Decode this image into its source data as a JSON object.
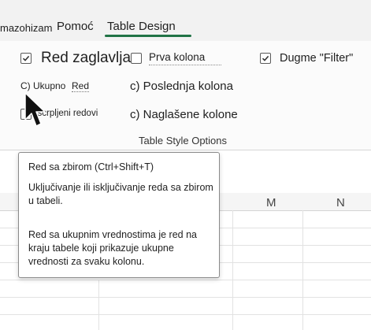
{
  "tabs": {
    "partial_left": "mazohizam",
    "help": "Pomoć",
    "table_design": "Table Design"
  },
  "ribbon": {
    "options": {
      "header_row": "Red zaglavlja",
      "first_column": "Prva kolona",
      "filter_button": "Dugme \"Filter\"",
      "total_row": "C) Ukupno",
      "total_row_suffix": "Red",
      "last_column": "c) Poslednja kolona",
      "banded_rows": "iscrpljeni redovi",
      "banded_columns": "c) Naglašene kolone"
    },
    "group_title": "Table Style Options"
  },
  "sheet": {
    "column_headers": [
      "M",
      "N"
    ]
  },
  "tooltip": {
    "title": "Red sa zbirom (Ctrl+Shift+T)",
    "paragraph1": "Uključivanje ili isključivanje reda sa zbirom u tabeli.",
    "paragraph2": "Red sa ukupnim vrednostima je red na kraju tabele koji prikazuje ukupne vrednosti za svaku kolonu."
  },
  "colors": {
    "accent": "#217346"
  },
  "icons": {
    "cursor": "mouse-pointer-icon",
    "check": "checkmark-icon"
  }
}
